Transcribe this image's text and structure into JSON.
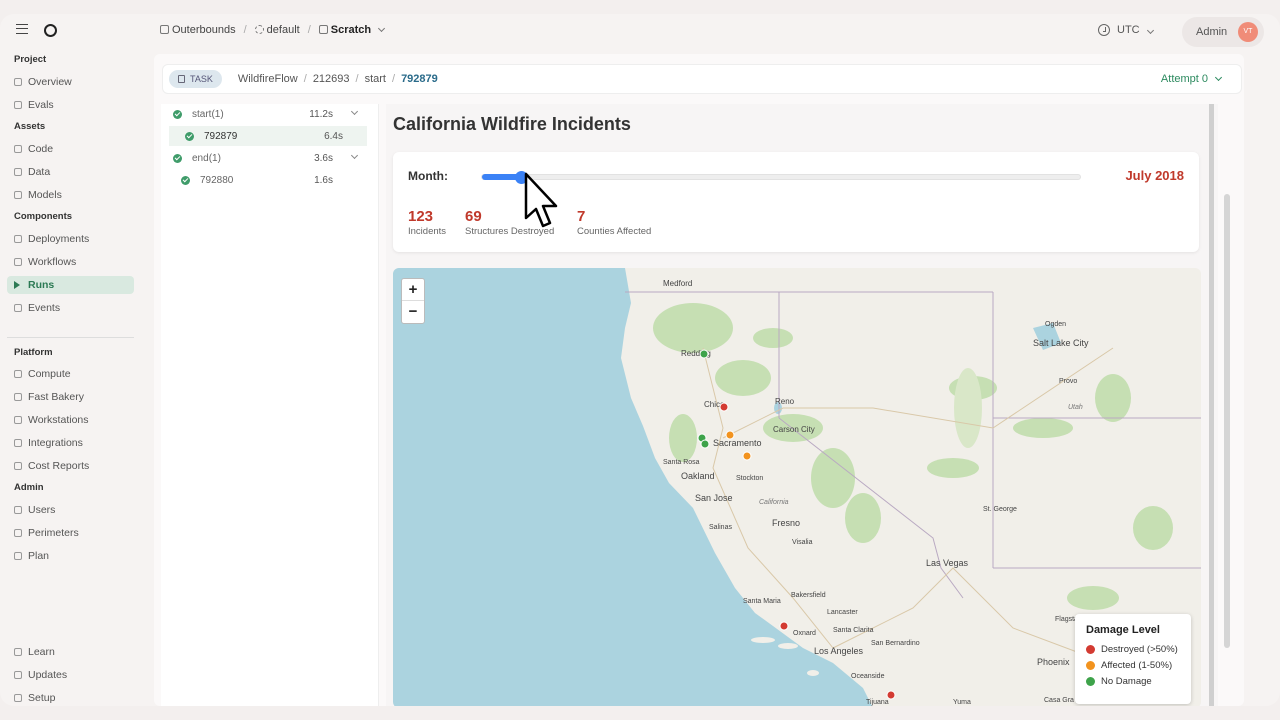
{
  "topbar": {
    "workspace": "Outerbounds",
    "perimeter": "default",
    "project": "Scratch",
    "timezone": "UTC",
    "user": "Admin",
    "avatar_initials": "VT"
  },
  "sidebar": {
    "sections": [
      {
        "title": "Project",
        "items": [
          "Overview",
          "Evals"
        ]
      },
      {
        "title": "Assets",
        "items": [
          "Code",
          "Data",
          "Models"
        ]
      },
      {
        "title": "Components",
        "items": [
          "Deployments",
          "Workflows",
          "Runs",
          "Events"
        ]
      },
      {
        "title": "Platform",
        "items": [
          "Compute",
          "Fast Bakery",
          "Workstations",
          "Integrations",
          "Cost Reports"
        ]
      },
      {
        "title": "Admin",
        "items": [
          "Users",
          "Perimeters",
          "Plan"
        ]
      }
    ],
    "active_item": "Runs",
    "footer": [
      "Learn",
      "Updates",
      "Setup"
    ]
  },
  "task_header": {
    "tag": "TASK",
    "crumbs": [
      "WildfireFlow",
      "212693",
      "start",
      "792879"
    ],
    "attempt": "Attempt 0"
  },
  "steps": [
    {
      "name": "start",
      "count": "(1)",
      "duration": "11.2s"
    },
    {
      "name": "792879",
      "duration": "6.4s"
    },
    {
      "name": "end",
      "count": "(1)",
      "duration": "3.6s"
    },
    {
      "name": "792880",
      "duration": "1.6s"
    }
  ],
  "dashboard": {
    "title": "California Wildfire Incidents",
    "slider_label": "Month:",
    "slider_value": "July 2018",
    "slider_fraction": 0.055,
    "stats": [
      {
        "value": "123",
        "label": "Incidents"
      },
      {
        "value": "69",
        "label": "Structures Destroyed"
      },
      {
        "value": "7",
        "label": "Counties Affected"
      }
    ]
  },
  "map": {
    "zoom_in": "+",
    "zoom_out": "−",
    "cities": [
      "Medford",
      "Redding",
      "Chico",
      "Reno",
      "Carson City",
      "Sacramento",
      "Santa Rosa",
      "Oakland",
      "San Jose",
      "Stockton",
      "California",
      "Salinas",
      "Fresno",
      "Visalia",
      "Bakersfield",
      "Santa Maria",
      "Oxnard",
      "Lancaster",
      "Santa Clarita",
      "Los Angeles",
      "San Bernardino",
      "Oceanside",
      "Tijuana",
      "Las Vegas",
      "St. George",
      "Flagstaff",
      "Phoenix",
      "Casa Gra",
      "Yuma",
      "Ogden",
      "Salt Lake City",
      "Provo",
      "Utah"
    ],
    "legend": {
      "title": "Damage Level",
      "entries": [
        {
          "label": "Destroyed (>50%)",
          "color": "#d33b32"
        },
        {
          "label": "Affected (1-50%)",
          "color": "#f2931e"
        },
        {
          "label": "No Damage",
          "color": "#3ea34a"
        }
      ]
    }
  }
}
